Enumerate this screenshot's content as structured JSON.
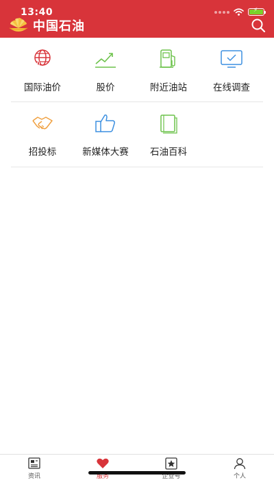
{
  "status": {
    "time": "13:40"
  },
  "header": {
    "title": "中国石油"
  },
  "services": [
    {
      "label": "国际油价",
      "icon": "globe-oil-drop-icon",
      "color": "#d8343a"
    },
    {
      "label": "股价",
      "icon": "stock-trend-icon",
      "color": "#6cc24a"
    },
    {
      "label": "附近油站",
      "icon": "gas-pump-icon",
      "color": "#6cc24a"
    },
    {
      "label": "在线调查",
      "icon": "monitor-check-icon",
      "color": "#3b8fe0"
    },
    {
      "label": "招投标",
      "icon": "handshake-icon",
      "color": "#f0a040"
    },
    {
      "label": "新媒体大赛",
      "icon": "thumbs-up-icon",
      "color": "#3b8fe0"
    },
    {
      "label": "石油百科",
      "icon": "book-icon",
      "color": "#6cc24a"
    }
  ],
  "bottom_nav": [
    {
      "label": "资讯",
      "icon": "news-icon",
      "active": false
    },
    {
      "label": "服务",
      "icon": "heart-icon",
      "active": true
    },
    {
      "label": "企业号",
      "icon": "star-badge-icon",
      "active": false
    },
    {
      "label": "个人",
      "icon": "person-icon",
      "active": false
    }
  ],
  "colors": {
    "brand_red": "#d8343a",
    "accent_green": "#6cc24a",
    "accent_blue": "#3b8fe0",
    "accent_orange": "#f0a040"
  }
}
